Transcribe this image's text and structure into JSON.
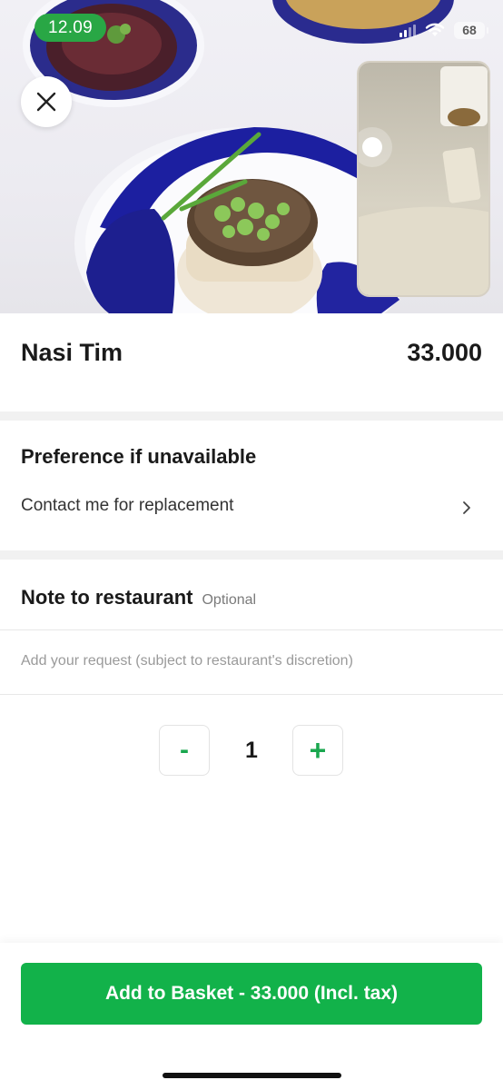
{
  "status_bar": {
    "time": "12.09",
    "battery": "68"
  },
  "item": {
    "name": "Nasi Tim",
    "price": "33.000"
  },
  "preference": {
    "title": "Preference if unavailable",
    "value": "Contact me for replacement"
  },
  "note": {
    "title": "Note to restaurant",
    "optional_label": "Optional",
    "placeholder": "Add your request (subject to restaurant's discretion)"
  },
  "quantity": {
    "minus": "-",
    "value": "1",
    "plus": "+"
  },
  "cta": {
    "label": "Add to Basket - 33.000 (Incl. tax)"
  },
  "colors": {
    "brand_green": "#12b24a",
    "time_pill": "#29a745"
  },
  "icons": [
    "close-icon",
    "signal-icon",
    "wifi-icon",
    "battery-icon",
    "chevron-right-icon"
  ]
}
